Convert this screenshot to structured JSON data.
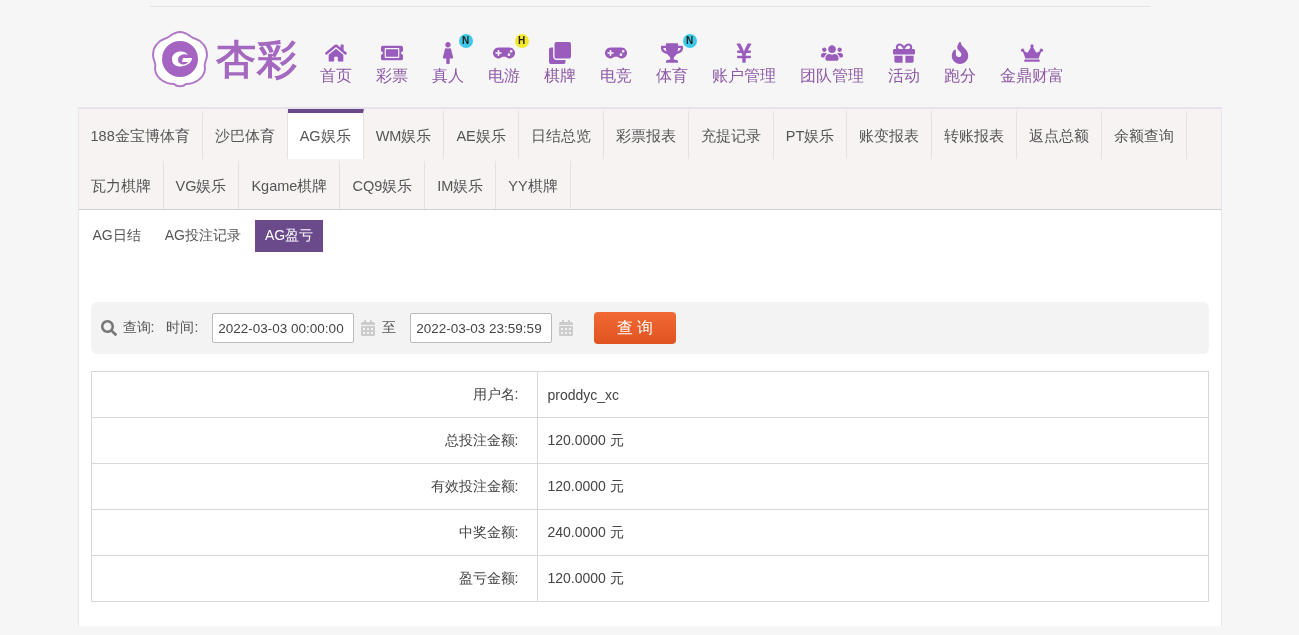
{
  "logo": {
    "text": "杏彩"
  },
  "nav": [
    {
      "label": "首页"
    },
    {
      "label": "彩票"
    },
    {
      "label": "真人",
      "badge": "N",
      "color": "#3ec9e8"
    },
    {
      "label": "电游",
      "badge": "H",
      "color": "#f4ea2a"
    },
    {
      "label": "棋牌"
    },
    {
      "label": "电竞"
    },
    {
      "label": "体育",
      "badge": "N",
      "color": "#3ec9e8"
    },
    {
      "label": "账户管理"
    },
    {
      "label": "团队管理"
    },
    {
      "label": "活动"
    },
    {
      "label": "跑分"
    },
    {
      "label": "金鼎财富"
    }
  ],
  "tab_rows": [
    [
      {
        "label": "188金宝博体育",
        "selected": false
      },
      {
        "label": "沙巴体育",
        "selected": false
      },
      {
        "label": "AG娱乐",
        "selected": true
      },
      {
        "label": "WM娱乐",
        "selected": false
      },
      {
        "label": "AE娱乐",
        "selected": false
      },
      {
        "label": "日结总览",
        "selected": false
      },
      {
        "label": "彩票报表",
        "selected": false
      },
      {
        "label": "充提记录",
        "selected": false
      },
      {
        "label": "PT娱乐",
        "selected": false
      },
      {
        "label": "账变报表",
        "selected": false
      },
      {
        "label": "转账报表",
        "selected": false
      },
      {
        "label": "返点总额",
        "selected": false
      },
      {
        "label": "余额查询",
        "selected": false
      }
    ],
    [
      {
        "label": "瓦力棋牌",
        "selected": false
      },
      {
        "label": "VG娱乐",
        "selected": false
      },
      {
        "label": "Kgame棋牌",
        "selected": false
      },
      {
        "label": "CQ9娱乐",
        "selected": false
      },
      {
        "label": "IM娱乐",
        "selected": false
      },
      {
        "label": "YY棋牌",
        "selected": false
      }
    ]
  ],
  "sub_tabs": [
    {
      "label": "AG日结",
      "selected": false
    },
    {
      "label": "AG投注记录",
      "selected": false
    },
    {
      "label": "AG盈亏",
      "selected": true
    }
  ],
  "query": {
    "label": "查询:",
    "time_label": "时间:",
    "start": "2022-03-03 00:00:00",
    "separator": "至",
    "end": "2022-03-03 23:59:59",
    "button": "查 询"
  },
  "result": {
    "rows": [
      {
        "label": "用户名:",
        "value": "proddyc_xc"
      },
      {
        "label": "总投注金额:",
        "value": "120.0000 元"
      },
      {
        "label": "有效投注金额:",
        "value": "120.0000 元"
      },
      {
        "label": "中奖金额:",
        "value": "240.0000 元"
      },
      {
        "label": "盈亏金额:",
        "value": "120.0000 元"
      }
    ]
  }
}
